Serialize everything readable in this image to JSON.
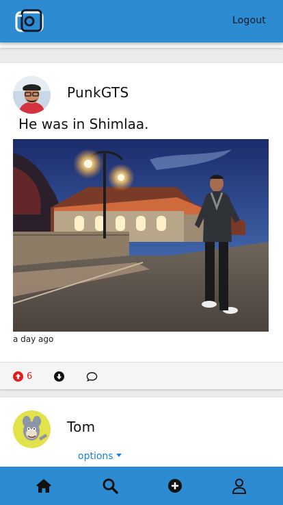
{
  "header": {
    "logout_label": "Logout"
  },
  "feed": {
    "posts": [
      {
        "username": "PunkGTS",
        "caption": "He was in Shimlaa.",
        "time": "a day ago",
        "upvotes": "6"
      },
      {
        "username": "Tom",
        "options_label": "options"
      }
    ]
  },
  "colors": {
    "brand": "#2d8bd1",
    "upvote": "#e21b1b",
    "link": "#1a7fd6"
  },
  "icons": {
    "upvote": "arrow-circle-up-icon",
    "downvote": "arrow-circle-down-icon",
    "comment": "comment-icon",
    "home": "home-icon",
    "search": "search-icon",
    "add": "plus-circle-icon",
    "profile": "user-icon"
  }
}
